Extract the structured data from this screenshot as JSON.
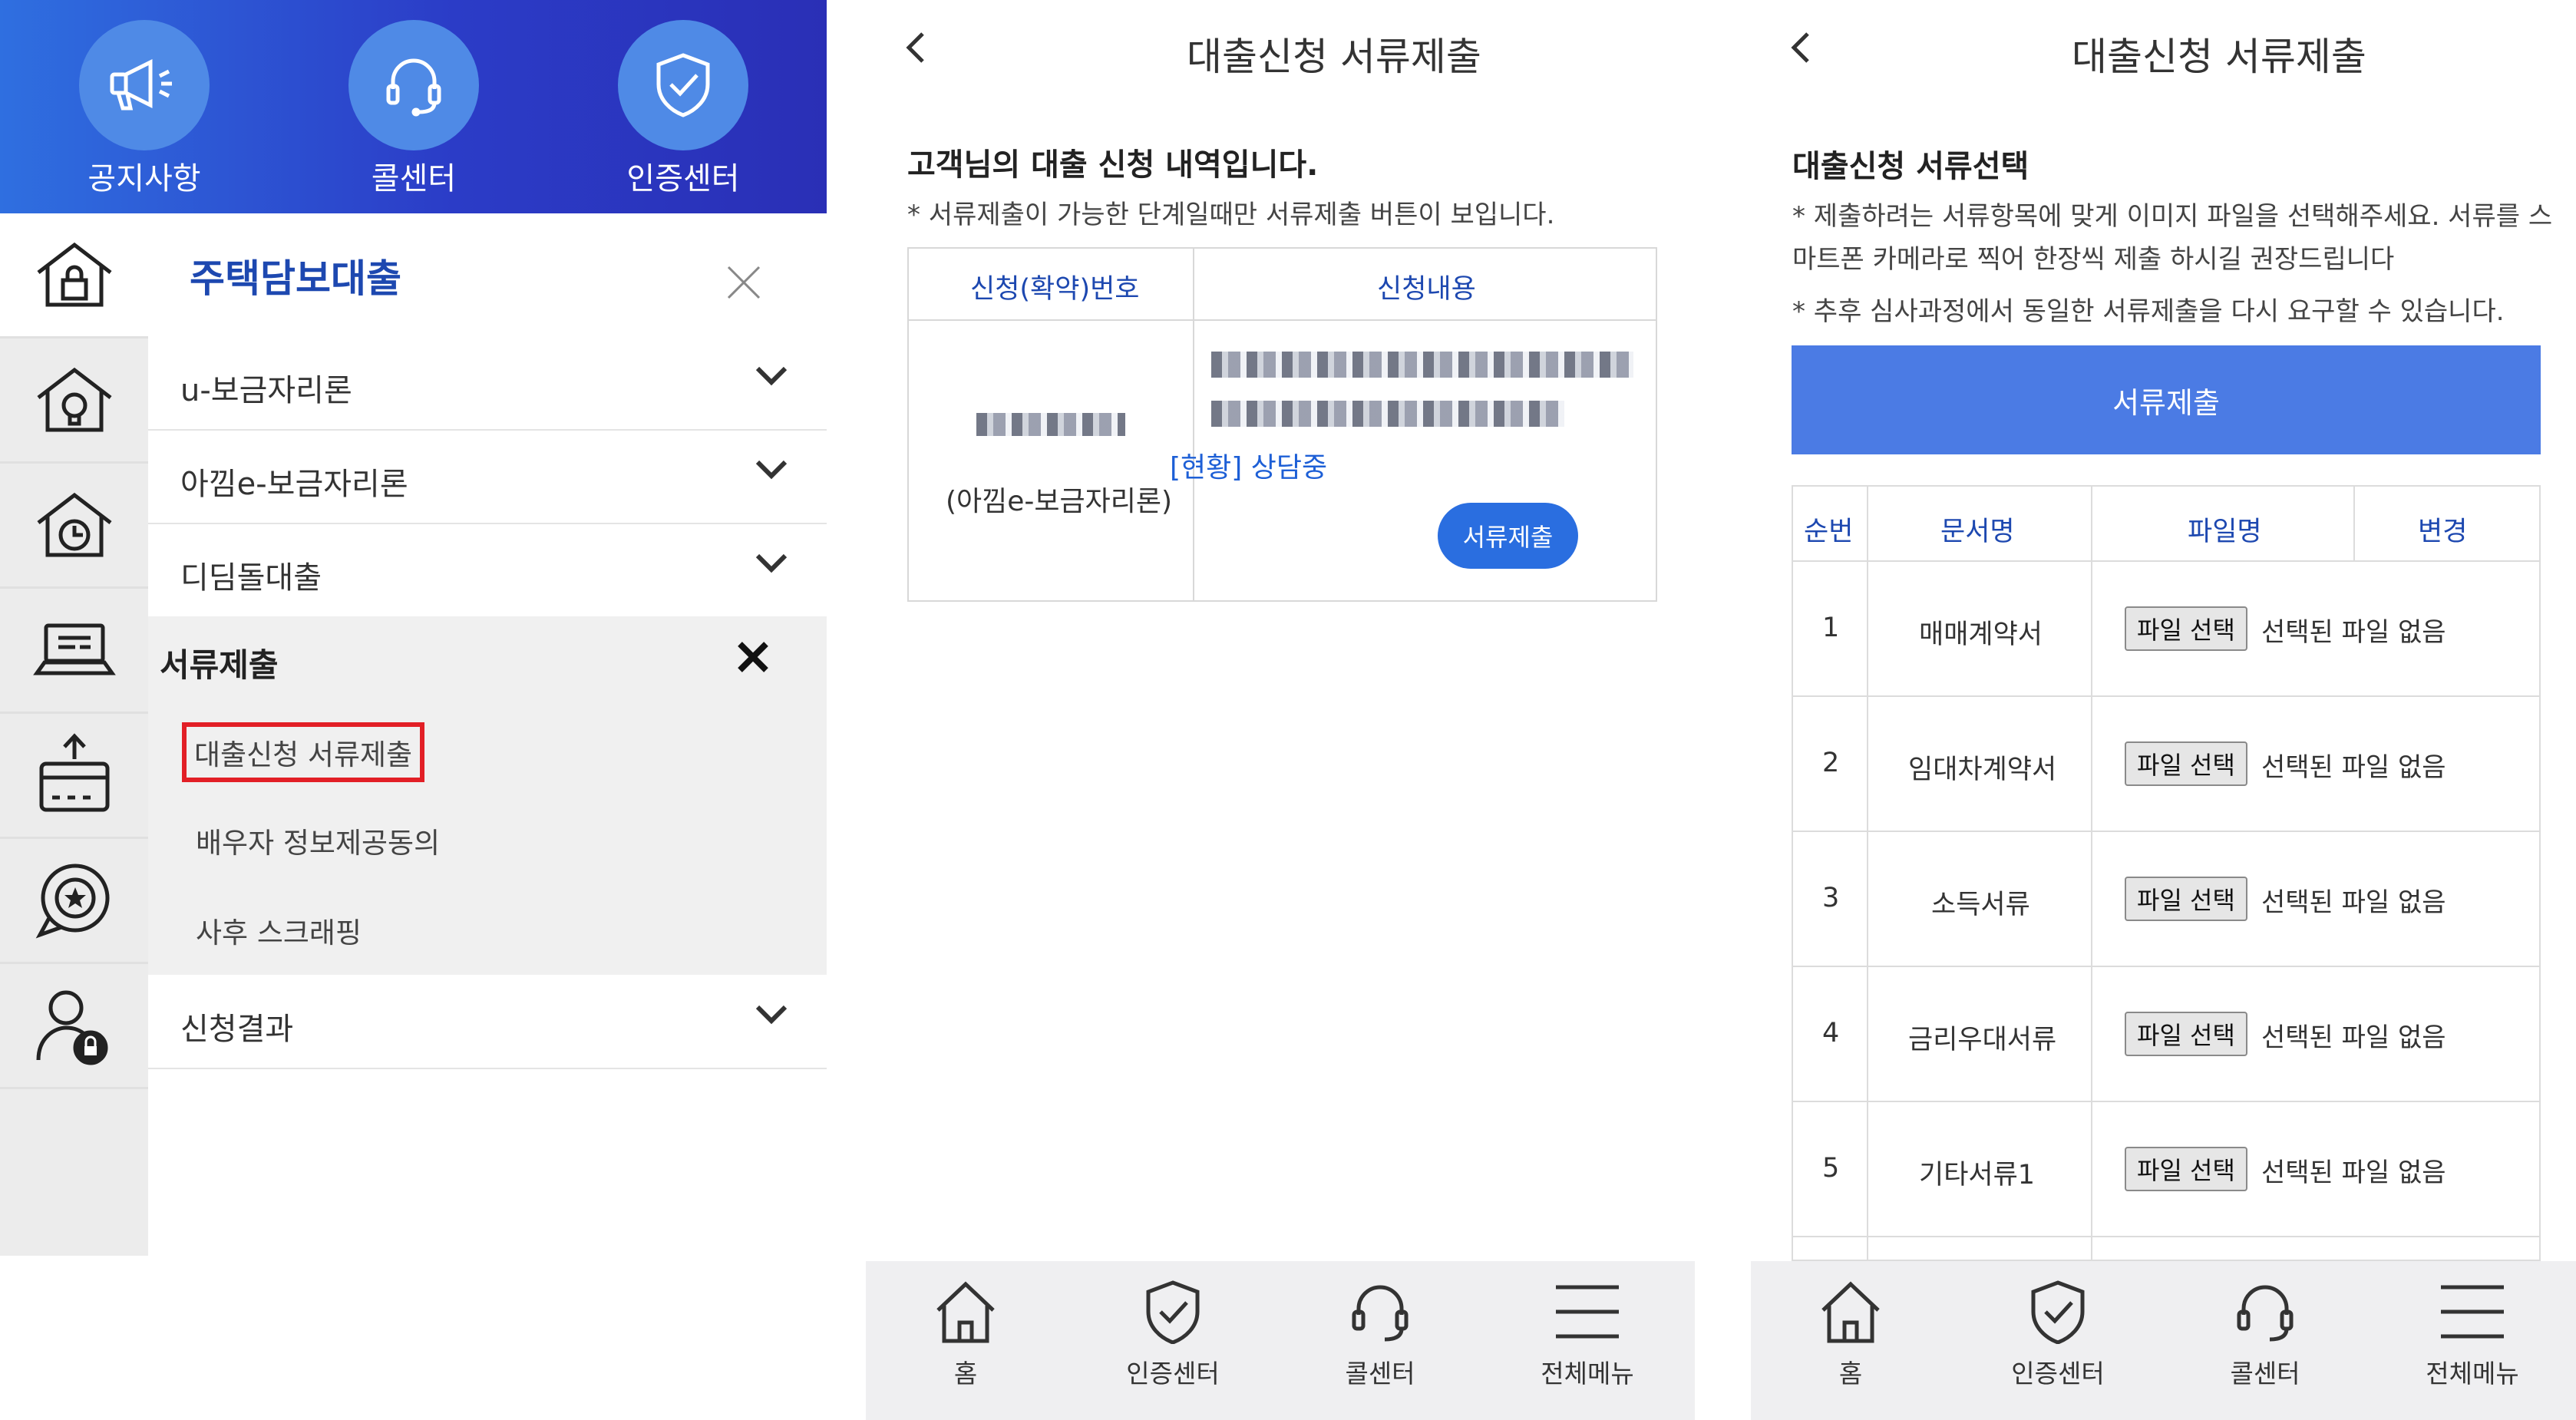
{
  "panel1": {
    "hero": [
      {
        "label": "공지사항",
        "icon": "megaphone-icon"
      },
      {
        "label": "콜센터",
        "icon": "headset-icon"
      },
      {
        "label": "인증센터",
        "icon": "shield-check-icon"
      }
    ],
    "rail": [
      "house-lock-icon",
      "house-bulb-icon",
      "house-clock-icon",
      "laptop-icon",
      "card-upload-icon",
      "star-chat-icon",
      "user-lock-icon"
    ],
    "menu_title": "주택담보대출",
    "menu_items": [
      "u-보금자리론",
      "아낌e-보금자리론",
      "디딤돌대출"
    ],
    "section_title": "서류제출",
    "sub_items": [
      "대출신청 서류제출",
      "배우자 정보제공동의",
      "사후 스크래핑"
    ],
    "last_item": "신청결과"
  },
  "panel2": {
    "title": "대출신청 서류제출",
    "heading": "고객님의 대출 신청 내역입니다.",
    "note": "* 서류제출이 가능한 단계일때만 서류제출 버튼이 보입니다.",
    "col1": "신청(확약)번호",
    "col2": "신청내용",
    "product": "(아낌e-보금자리론)",
    "status": "[현황] 상담중",
    "submit": "서류제출"
  },
  "panel3": {
    "title": "대출신청 서류제출",
    "heading": "대출신청 서류선택",
    "note1": "* 제출하려는 서류항목에 맞게 이미지 파일을 선택해주세요. 서류를 스마트폰 카메라로 찍어 한장씩 제출 하시길 권장드립니다",
    "note2": "* 추후 심사과정에서 동일한 서류제출을 다시 요구할 수 있습니다.",
    "submit": "서류제출",
    "headers": [
      "순번",
      "문서명",
      "파일명",
      "변경"
    ],
    "rows": [
      {
        "no": "1",
        "doc": "매매계약서"
      },
      {
        "no": "2",
        "doc": "임대차계약서"
      },
      {
        "no": "3",
        "doc": "소득서류"
      },
      {
        "no": "4",
        "doc": "금리우대서류"
      },
      {
        "no": "5",
        "doc": "기타서류1"
      }
    ],
    "file_button": "파일 선택",
    "no_file": "선택된 파일 없음"
  },
  "bottom_nav": [
    "홈",
    "인증센터",
    "콜센터",
    "전체메뉴"
  ]
}
